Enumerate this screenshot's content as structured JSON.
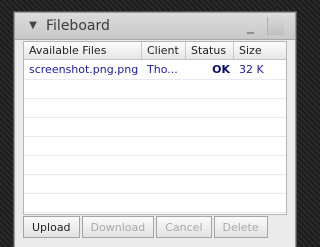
{
  "window": {
    "title": "Fileboard",
    "collapse_glyph": "▼",
    "minimize_glyph": "_"
  },
  "table": {
    "columns": [
      "Available Files",
      "Client",
      "Status",
      "Size"
    ],
    "rows": [
      {
        "file": "screenshot.png.png",
        "client": "Tho...",
        "status": "OK",
        "size": "32 K"
      }
    ]
  },
  "buttons": {
    "upload": "Upload",
    "download": "Download",
    "cancel": "Cancel",
    "delete": "Delete"
  }
}
